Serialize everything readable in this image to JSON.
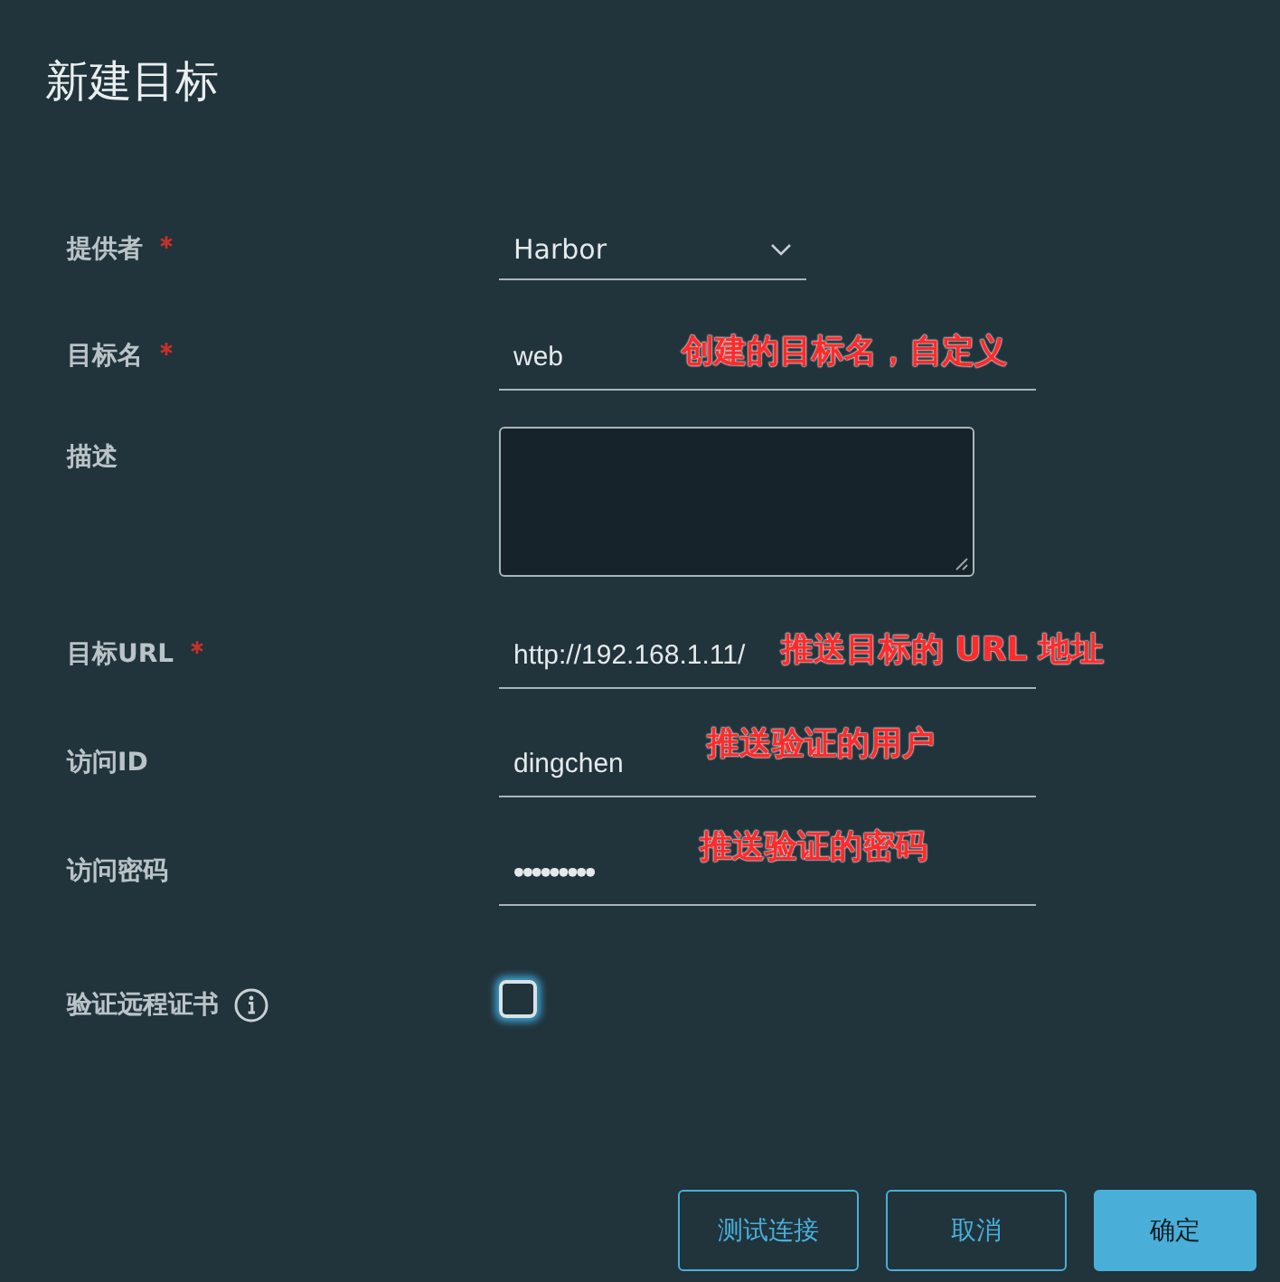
{
  "dialog": {
    "title": "新建目标"
  },
  "fields": [
    {
      "kind": "select",
      "label": "提供者",
      "required": true,
      "value": "Harbor"
    },
    {
      "kind": "text",
      "label": "目标名",
      "required": true,
      "value": "web",
      "annotation": "创建的目标名，自定义"
    },
    {
      "kind": "textarea",
      "label": "描述",
      "required": false
    },
    {
      "kind": "text",
      "label": "目标URL",
      "required": true,
      "value": "http://192.168.1.11/",
      "annotation": "推送目标的 URL 地址"
    },
    {
      "kind": "text",
      "label": "访问ID",
      "required": false,
      "value": "dingchen",
      "annotation": "推送验证的用户"
    },
    {
      "kind": "password",
      "label": "访问密码",
      "required": false,
      "value": "•••••••••",
      "annotation": "推送验证的密码"
    },
    {
      "kind": "checkbox",
      "label": "验证远程证书",
      "required": false,
      "info": true,
      "checked": false
    }
  ],
  "buttons": [
    {
      "label": "测试连接",
      "primary": false
    },
    {
      "label": "取消",
      "primary": false
    },
    {
      "label": "确定",
      "primary": true
    }
  ]
}
